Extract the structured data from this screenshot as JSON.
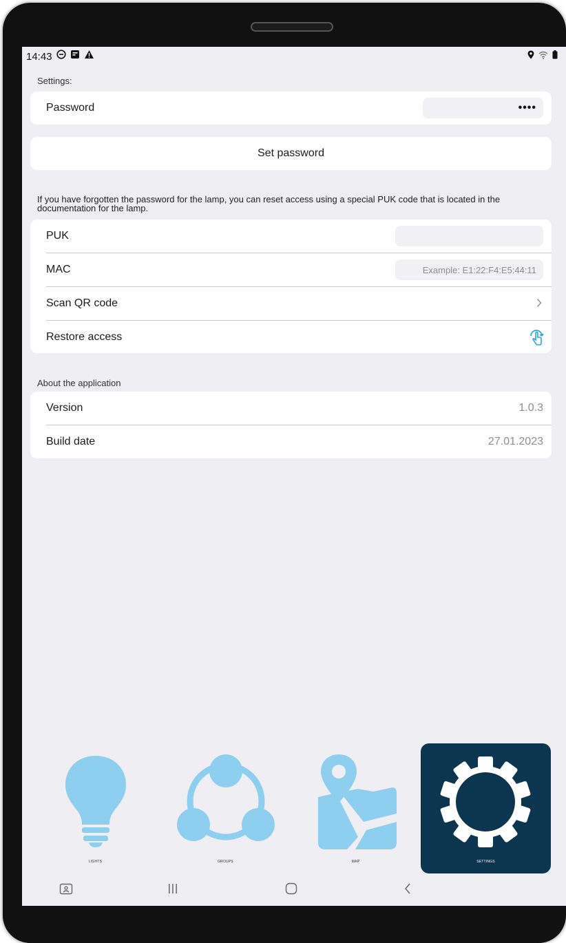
{
  "status_bar": {
    "time": "14:43",
    "left_icons": [
      "do-not-disturb-icon",
      "app-notification-icon",
      "warning-icon"
    ],
    "right_icons": [
      "location-icon",
      "wifi-icon",
      "battery-icon"
    ]
  },
  "settings": {
    "section_label": "Settings:",
    "password_label": "Password",
    "password_value": "••••",
    "set_password_label": "Set password"
  },
  "restore": {
    "note": "If you have forgotten the password for the lamp, you can reset access using a special PUK code that is located in the documentation for the lamp.",
    "puk_label": "PUK",
    "puk_value": "",
    "mac_label": "MAC",
    "mac_placeholder": "Example: E1:22:F4:E5:44:11",
    "scan_qr_label": "Scan QR code",
    "restore_label": "Restore access"
  },
  "about": {
    "section_label": "About the application",
    "version_label": "Version",
    "version_value": "1.0.3",
    "build_date_label": "Build date",
    "build_date_value": "27.01.2023"
  },
  "tabs": [
    {
      "label": "LIGHTS",
      "icon": "lightbulb-icon",
      "active": false
    },
    {
      "label": "GROUPS",
      "icon": "groups-icon",
      "active": false
    },
    {
      "label": "MAP",
      "icon": "map-icon",
      "active": false
    },
    {
      "label": "SETTINGS",
      "icon": "gear-icon",
      "active": true
    }
  ],
  "colors": {
    "accent": "#8ecfef",
    "active_tab": "#0c3550",
    "background": "#efeef3",
    "restore_icon": "#2ba7dc"
  },
  "nav_bar": [
    "recent-screenshot-icon",
    "recents-icon",
    "home-icon",
    "back-icon"
  ]
}
